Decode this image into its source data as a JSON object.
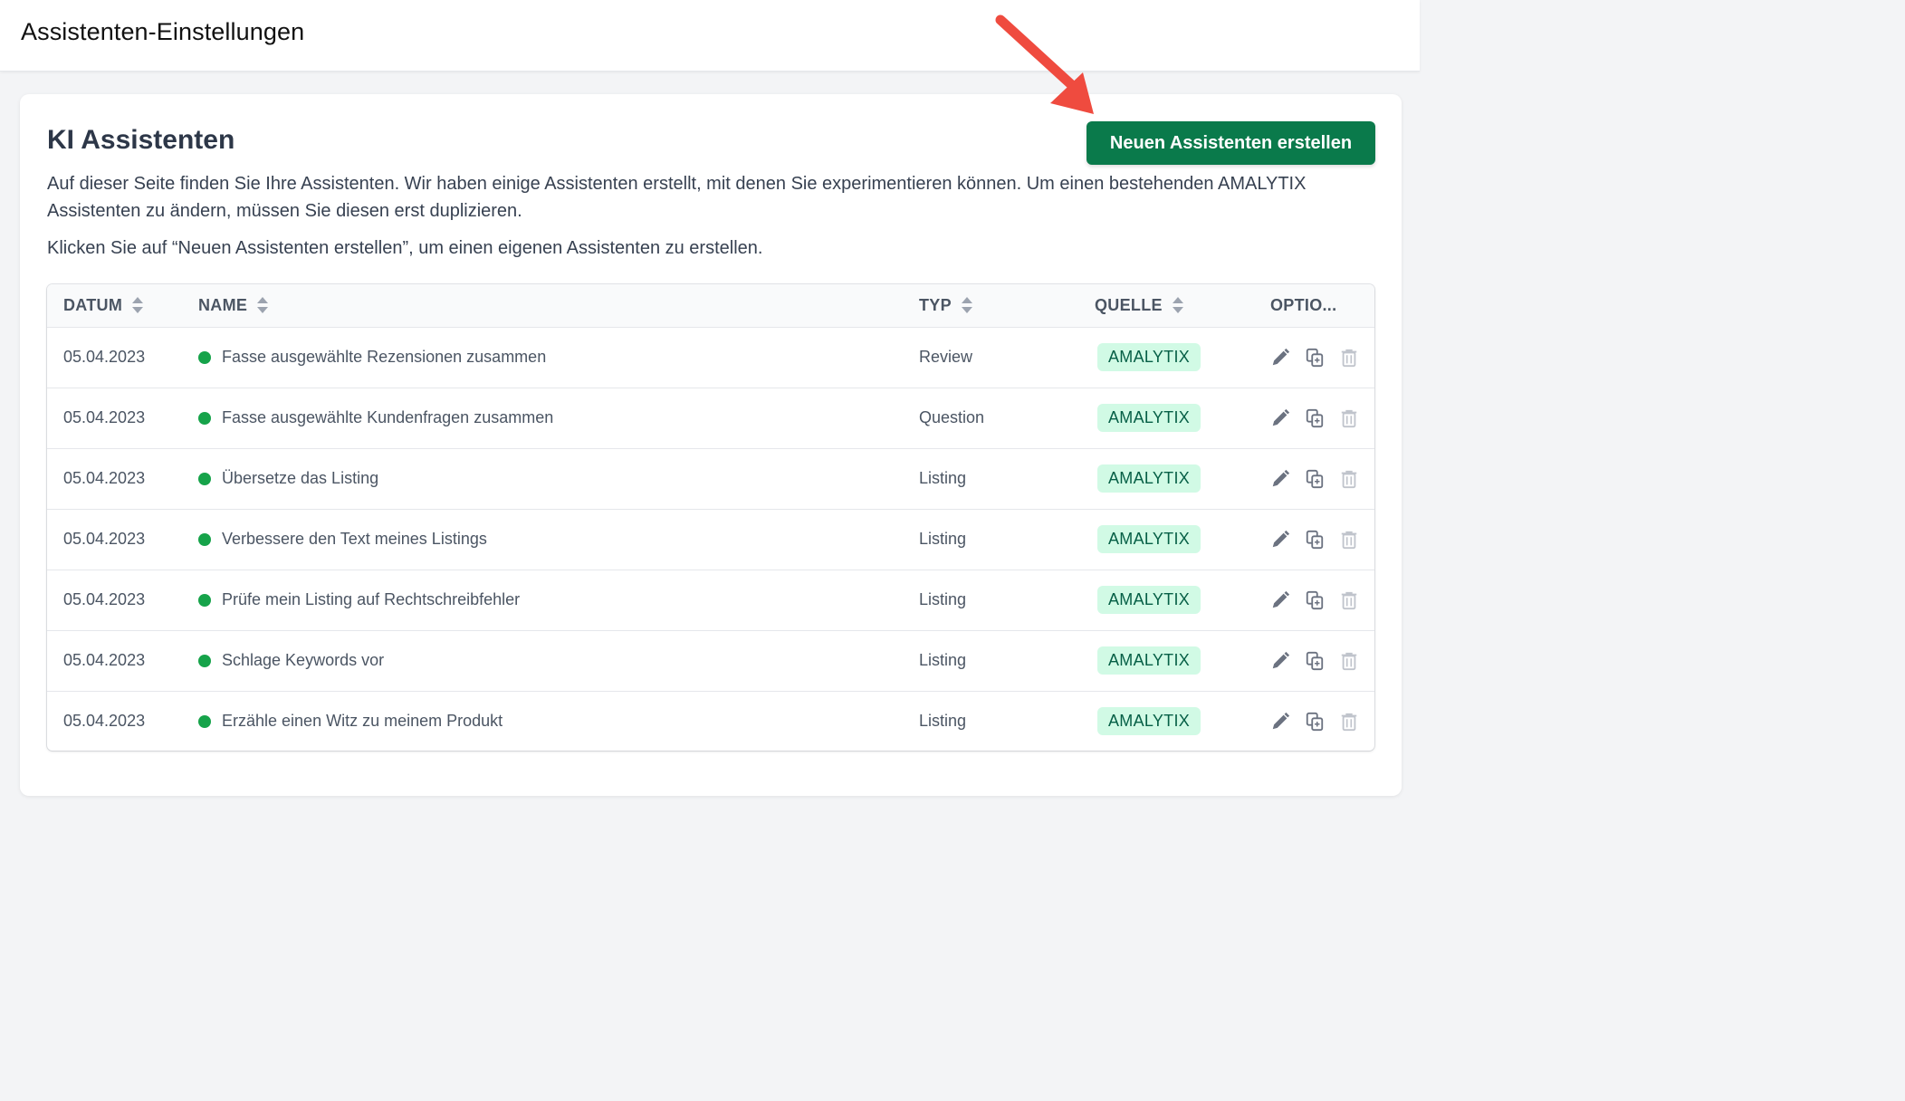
{
  "header": {
    "title": "Assistenten-Einstellungen"
  },
  "card": {
    "title": "KI Assistenten",
    "create_button": "Neuen Assistenten erstellen",
    "description_1": "Auf dieser Seite finden Sie Ihre Assistenten. Wir haben einige Assistenten erstellt, mit denen Sie experimentieren können. Um einen bestehenden AMALYTIX Assistenten zu ändern, müssen Sie diesen erst duplizieren.",
    "description_2": "Klicken Sie auf “Neuen Assistenten erstellen”, um einen eigenen Assistenten zu erstellen."
  },
  "table": {
    "columns": {
      "date": "DATUM",
      "name": "NAME",
      "type": "TYP",
      "source": "QUELLE",
      "options": "OPTIO..."
    },
    "rows": [
      {
        "date": "05.04.2023",
        "name": "Fasse ausgewählte Rezensionen zusammen",
        "type": "Review",
        "source": "AMALYTIX"
      },
      {
        "date": "05.04.2023",
        "name": "Fasse ausgewählte Kundenfragen zusammen",
        "type": "Question",
        "source": "AMALYTIX"
      },
      {
        "date": "05.04.2023",
        "name": "Übersetze das Listing",
        "type": "Listing",
        "source": "AMALYTIX"
      },
      {
        "date": "05.04.2023",
        "name": "Verbessere den Text meines Listings",
        "type": "Listing",
        "source": "AMALYTIX"
      },
      {
        "date": "05.04.2023",
        "name": "Prüfe mein Listing auf Rechtschreibfehler",
        "type": "Listing",
        "source": "AMALYTIX"
      },
      {
        "date": "05.04.2023",
        "name": "Schlage Keywords vor",
        "type": "Listing",
        "source": "AMALYTIX"
      },
      {
        "date": "05.04.2023",
        "name": "Erzähle einen Witz zu meinem Produkt",
        "type": "Listing",
        "source": "AMALYTIX"
      }
    ]
  },
  "icons": {
    "sort": "sort-icon",
    "status": "status-dot-icon",
    "edit": "pencil-icon",
    "duplicate": "duplicate-icon",
    "delete": "trash-icon",
    "annotation": "red-arrow-annotation"
  },
  "colors": {
    "primary": "#0a7a4b",
    "status_active": "#16a34a",
    "badge_bg": "#d1fae5",
    "badge_text": "#065f46",
    "arrow": "#ef4b3f"
  }
}
